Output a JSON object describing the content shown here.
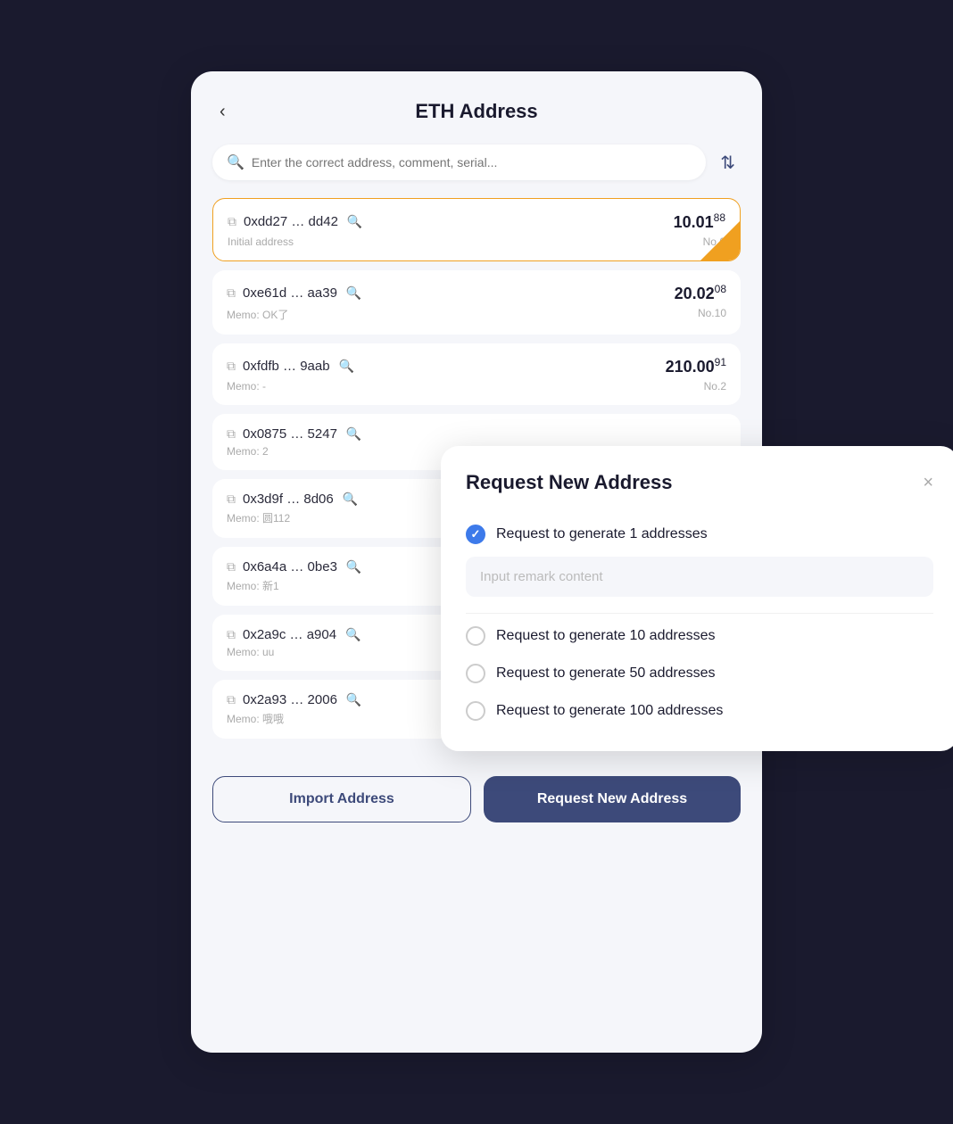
{
  "header": {
    "back_label": "‹",
    "title": "ETH Address"
  },
  "search": {
    "placeholder": "Enter the correct address, comment, serial..."
  },
  "address_list": [
    {
      "addr": "0xdd27 … dd42",
      "amount_main": "10.01",
      "amount_sup": "88",
      "memo": "Initial address",
      "no": "No.0",
      "first": true
    },
    {
      "addr": "0xe61d … aa39",
      "amount_main": "20.02",
      "amount_sup": "08",
      "memo": "Memo: OK了",
      "no": "No.10",
      "first": false
    },
    {
      "addr": "0xfdfb … 9aab",
      "amount_main": "210.00",
      "amount_sup": "91",
      "memo": "Memo: -",
      "no": "No.2",
      "first": false
    },
    {
      "addr": "0x0875 … 5247",
      "amount_main": "",
      "amount_sup": "",
      "memo": "Memo: 2",
      "no": "",
      "first": false
    },
    {
      "addr": "0x3d9f … 8d06",
      "amount_main": "",
      "amount_sup": "",
      "memo": "Memo: 圆112",
      "no": "",
      "first": false
    },
    {
      "addr": "0x6a4a … 0be3",
      "amount_main": "",
      "amount_sup": "",
      "memo": "Memo: 新1",
      "no": "",
      "first": false
    },
    {
      "addr": "0x2a9c … a904",
      "amount_main": "",
      "amount_sup": "",
      "memo": "Memo: uu",
      "no": "",
      "first": false
    },
    {
      "addr": "0x2a93 … 2006",
      "amount_main": "",
      "amount_sup": "",
      "memo": "Memo: 哦哦",
      "no": "",
      "first": false
    }
  ],
  "footer": {
    "import_label": "Import Address",
    "request_label": "Request New Address"
  },
  "modal": {
    "title": "Request New Address",
    "close_label": "×",
    "remark_placeholder": "Input remark content",
    "options": [
      {
        "label": "Request to generate 1 addresses",
        "checked": true
      },
      {
        "label": "Request to generate 10 addresses",
        "checked": false
      },
      {
        "label": "Request to generate 50 addresses",
        "checked": false
      },
      {
        "label": "Request to generate 100 addresses",
        "checked": false
      }
    ]
  }
}
